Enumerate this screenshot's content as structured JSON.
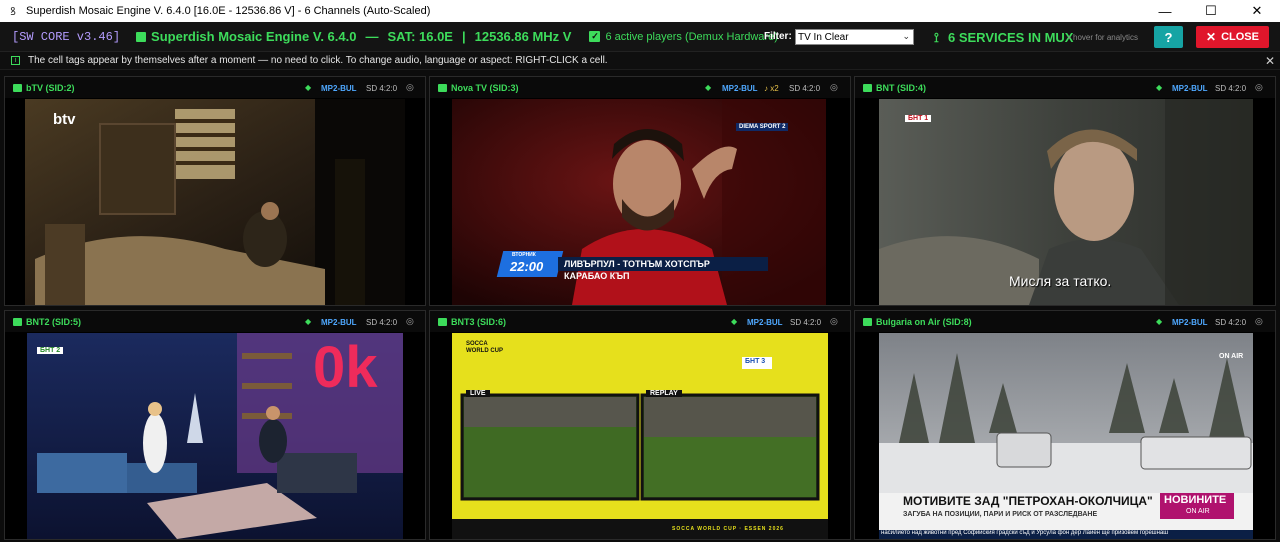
{
  "window": {
    "icon": "satellite-dish-icon",
    "title": "Superdish Mosaic Engine V. 6.4.0 [16.0E - 12536.86 V] - 6 Channels (Auto-Scaled)",
    "controls": {
      "minimize": "—",
      "maximize": "☐",
      "close": "✕"
    }
  },
  "toolbar": {
    "core": "[SW CORE v3.46]",
    "engine_title": "Superdish Mosaic Engine V. 6.4.0",
    "sep1": "—",
    "sat": "SAT: 16.0E",
    "sep2": "|",
    "freq": "12536.86 MHz V",
    "players_check": "✓",
    "players": "6 active players (Demux Hardware)",
    "filter_label": "Filter:",
    "filter_value": "TV In Clear",
    "filter_chevron": "⌄",
    "services_icon": "signal-icon",
    "services_glyph": "⟟",
    "services": "6  SERVICES IN MUX",
    "services_hint": "• hover for analytics",
    "help_label": "?",
    "close_x": "✕",
    "close_label": "CLOSE"
  },
  "infobar": {
    "icon": "i",
    "text": "The cell tags appear by themselves after a moment — no need to click.    To change audio, language or aspect:  RIGHT-CLICK a cell.",
    "close": "✕"
  },
  "cells": [
    {
      "name": "bTV (SID:2)",
      "diamond": "◆",
      "audio": "MP2-BUL",
      "audio_count": "",
      "aspect": "SD 4:2:0",
      "globe": "◎",
      "overlay_logo": "btv"
    },
    {
      "name": "Nova TV (SID:3)",
      "diamond": "◆",
      "audio": "MP2-BUL",
      "audio_count": "♪ x2",
      "aspect": "SD 4:2:0",
      "globe": "◎",
      "overlay_logo": "DIEMA SPORT 2",
      "lower_day": "ВТОРНИК",
      "lower_time": "22:00",
      "lower_title": "ЛИВЪРПУЛ - ТОТНЪМ ХОТСПЪР",
      "lower_sub": "КАРАБАО КЪП"
    },
    {
      "name": "BNT (SID:4)",
      "diamond": "◆",
      "audio": "MP2-BUL",
      "audio_count": "",
      "aspect": "SD 4:2:0",
      "globe": "◎",
      "overlay_logo": "БНТ 1",
      "subtitle": "Мисля за татко."
    },
    {
      "name": "BNT2 (SID:5)",
      "diamond": "◆",
      "audio": "MP2-BUL",
      "audio_count": "",
      "aspect": "SD 4:2:0",
      "globe": "◎",
      "overlay_logo": "БНТ 2",
      "set_text": "0k"
    },
    {
      "name": "BNT3 (SID:6)",
      "diamond": "◆",
      "audio": "MP2-BUL",
      "audio_count": "",
      "aspect": "SD 4:2:0",
      "globe": "◎",
      "overlay_logo": "БНТ 3",
      "event_logo": "SOCCA WORLD CUP",
      "live_label": "LIVE",
      "replay_label": "REPLAY",
      "footer": "SOCCA WORLD CUP  ·  ESSEN 2026"
    },
    {
      "name": "Bulgaria on Air (SID:8)",
      "diamond": "◆",
      "audio": "MP2-BUL",
      "audio_count": "",
      "aspect": "SD 4:2:0",
      "globe": "◎",
      "overlay_logo": "ON AIR",
      "headline": "МОТИВИТЕ ЗАД \"ПЕТРОХАН-ОКОЛЧИЦА\"",
      "headline_sub": "ЗАГУБА НА ПОЗИЦИИ, ПАРИ И РИСК ОТ РАЗСЛЕДВАНЕ",
      "news_badge": "НОВИНИТЕ",
      "news_badge_sub": "ON AIR",
      "ticker": "насилието над животни пред Софийския градски съд и Урсула фон дер Лайен ще призовем горешнаш"
    }
  ],
  "colors": {
    "accent_green": "#3ddc5b",
    "core_purple": "#b49cff",
    "audio_blue": "#4fa8ff",
    "close_red": "#e0162b",
    "help_teal": "#16a4a4",
    "background": "#0c0c0c"
  }
}
